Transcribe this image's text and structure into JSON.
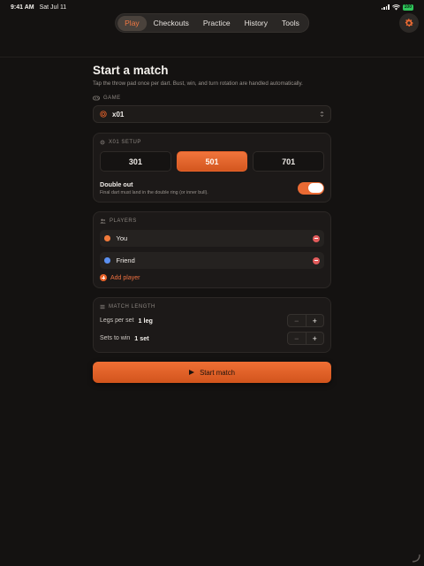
{
  "status_bar": {
    "time": "9:41 AM",
    "date": "Sat Jul 11",
    "battery": "100"
  },
  "nav": {
    "tabs": [
      {
        "label": "Play",
        "active": true
      },
      {
        "label": "Checkouts",
        "active": false
      },
      {
        "label": "Practice",
        "active": false
      },
      {
        "label": "History",
        "active": false
      },
      {
        "label": "Tools",
        "active": false
      }
    ],
    "settings_icon": "gear-icon"
  },
  "page": {
    "title": "Start a match",
    "subtitle": "Tap the throw pad once per dart. Bust, win, and turn rotation are handled automatically."
  },
  "game": {
    "label": "GAME",
    "value": "x01",
    "icon": "target-icon"
  },
  "x01_setup": {
    "label": "X01 SETUP",
    "variants": [
      "301",
      "501",
      "701"
    ],
    "selected": "501",
    "double_out": {
      "title": "Double out",
      "description": "Final dart must land in the double ring (or inner bull).",
      "enabled": true
    }
  },
  "players": {
    "label": "PLAYERS",
    "items": [
      {
        "name": "You",
        "color": "#f0793a"
      },
      {
        "name": "Friend",
        "color": "#5b8ff0"
      }
    ],
    "add_label": "Add player"
  },
  "match_length": {
    "label": "MATCH LENGTH",
    "legs_label": "Legs per set",
    "legs_value": "1 leg",
    "sets_label": "Sets to win",
    "sets_value": "1 set",
    "minus": "−",
    "plus": "+"
  },
  "start_button": {
    "label": "Start match"
  },
  "colors": {
    "accent": "#ea6a33",
    "background": "#141211",
    "remove": "#e15a5a"
  }
}
